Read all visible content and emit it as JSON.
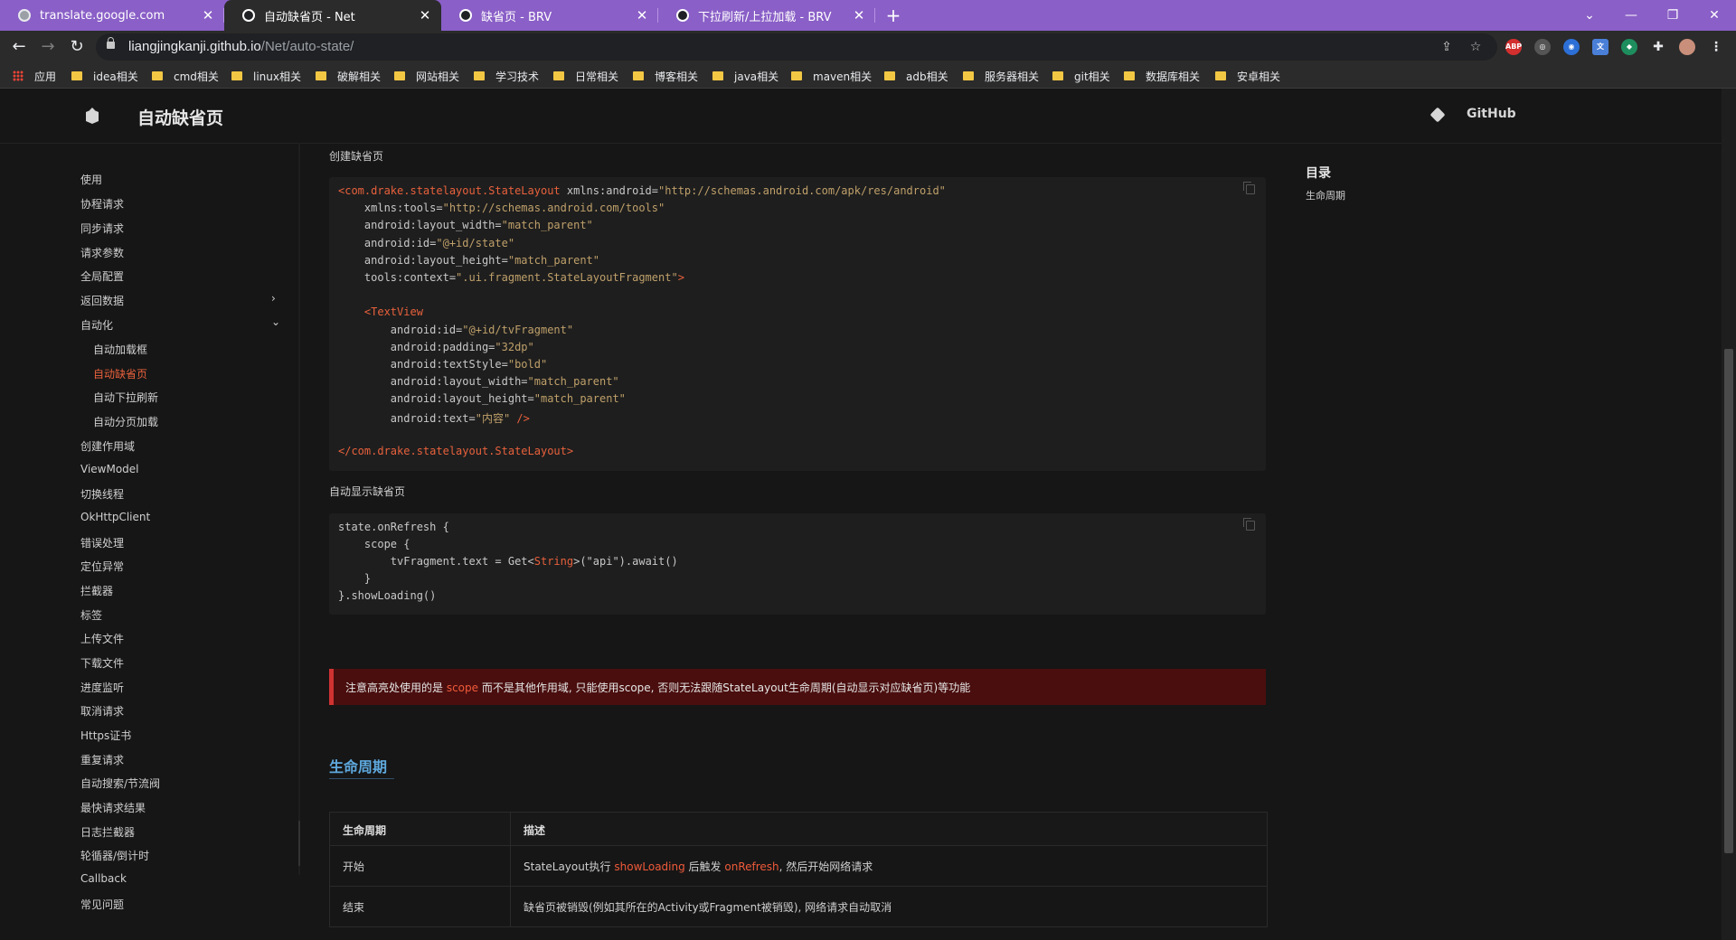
{
  "browser": {
    "tabs": [
      {
        "title": "translate.google.com",
        "active": false
      },
      {
        "title": "自动缺省页 - Net",
        "active": true
      },
      {
        "title": "缺省页 - BRV",
        "active": false
      },
      {
        "title": "下拉刷新/上拉加载 - BRV",
        "active": false
      }
    ],
    "new_tab": "+",
    "url_host": "liangjingkanji.github.io",
    "url_path": "/Net/auto-state/",
    "extensions": [
      "ABP"
    ],
    "bookmarks": [
      "应用",
      "idea相关",
      "cmd相关",
      "linux相关",
      "破解相关",
      "网站相关",
      "学习技术",
      "日常相关",
      "博客相关",
      "java相关",
      "maven相关",
      "adb相关",
      "服务器相关",
      "git相关",
      "数据库相关",
      "安卓相关"
    ]
  },
  "site": {
    "title": "自动缺省页",
    "github_label": "GitHub"
  },
  "sidebar": {
    "items": [
      "使用",
      "协程请求",
      "同步请求",
      "请求参数",
      "全局配置",
      "返回数据",
      "自动化",
      "自动加载框",
      "自动缺省页",
      "自动下拉刷新",
      "自动分页加载",
      "创建作用域",
      "ViewModel",
      "切换线程",
      "OkHttpClient",
      "错误处理",
      "定位异常",
      "拦截器",
      "标签",
      "上传文件",
      "下载文件",
      "进度监听",
      "取消请求",
      "Https证书",
      "重复请求",
      "自动搜索/节流阀",
      "最快请求结果",
      "日志拦截器",
      "轮循器/倒计时",
      "Callback",
      "常见问题"
    ],
    "active": "自动缺省页"
  },
  "content": {
    "label_create": "创建缺省页",
    "code1": {
      "l1_tag": "<com.drake.statelayout.StateLayout",
      "l1_attr": " xmlns:android=",
      "l1_val": "\"http://schemas.android.com/apk/res/android\"",
      "l2_attr": "    xmlns:tools=",
      "l2_val": "\"http://schemas.android.com/tools\"",
      "l3_attr": "    android:layout_width=",
      "l3_val": "\"match_parent\"",
      "l4_attr": "    android:id=",
      "l4_val": "\"@+id/state\"",
      "l5_attr": "    android:layout_height=",
      "l5_val": "\"match_parent\"",
      "l6_attr": "    tools:context=",
      "l6_val": "\".ui.fragment.StateLayoutFragment\"",
      "l6_end": ">",
      "l7_tag": "    <TextView",
      "l8_attr": "        android:id=",
      "l8_val": "\"@+id/tvFragment\"",
      "l9_attr": "        android:padding=",
      "l9_val": "\"32dp\"",
      "l10_attr": "        android:textStyle=",
      "l10_val": "\"bold\"",
      "l11_attr": "        android:layout_width=",
      "l11_val": "\"match_parent\"",
      "l12_attr": "        android:layout_height=",
      "l12_val": "\"match_parent\"",
      "l13_attr": "        android:text=",
      "l13_val": "\"内容\"",
      "l13_end": " />",
      "l14_tag": "</com.drake.statelayout.StateLayout>"
    },
    "label_auto": "自动显示缺省页",
    "code2": {
      "l1": "state.onRefresh {",
      "l2": "    scope {",
      "l3a": "        tvFragment.text = Get<",
      "l3b": "String",
      "l3c": ">(\"api\").await()",
      "l4": "    }",
      "l5": "}.showLoading()"
    },
    "warning": {
      "a": "注意高亮处使用的是 ",
      "hl": "scope",
      "b": " 而不是其他作用域, 只能使用scope, 否则无法跟随StateLayout生命周期(自动显示对应缺省页)等功能"
    },
    "section_title": "生命周期",
    "table": {
      "headers": [
        "生命周期",
        "描述"
      ],
      "row1_col1": "开始",
      "row1_a": "StateLayout执行 ",
      "row1_hl1": "showLoading",
      "row1_b": " 后触发 ",
      "row1_hl2": "onRefresh",
      "row1_c": ", 然后开始网络请求",
      "row2_col1": "结束",
      "row2_col2": "缺省页被销毁(例如其所在的Activity或Fragment被销毁), 网络请求自动取消"
    }
  },
  "toc": {
    "title": "目录",
    "items": [
      "生命周期"
    ]
  }
}
